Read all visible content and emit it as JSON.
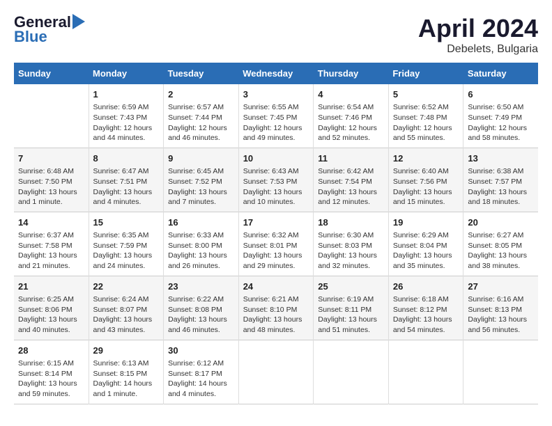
{
  "header": {
    "logo_line1": "General",
    "logo_line2": "Blue",
    "title": "April 2024",
    "subtitle": "Debelets, Bulgaria"
  },
  "days_of_week": [
    "Sunday",
    "Monday",
    "Tuesday",
    "Wednesday",
    "Thursday",
    "Friday",
    "Saturday"
  ],
  "weeks": [
    [
      {
        "day": "",
        "content": ""
      },
      {
        "day": "1",
        "content": "Sunrise: 6:59 AM\nSunset: 7:43 PM\nDaylight: 12 hours\nand 44 minutes."
      },
      {
        "day": "2",
        "content": "Sunrise: 6:57 AM\nSunset: 7:44 PM\nDaylight: 12 hours\nand 46 minutes."
      },
      {
        "day": "3",
        "content": "Sunrise: 6:55 AM\nSunset: 7:45 PM\nDaylight: 12 hours\nand 49 minutes."
      },
      {
        "day": "4",
        "content": "Sunrise: 6:54 AM\nSunset: 7:46 PM\nDaylight: 12 hours\nand 52 minutes."
      },
      {
        "day": "5",
        "content": "Sunrise: 6:52 AM\nSunset: 7:48 PM\nDaylight: 12 hours\nand 55 minutes."
      },
      {
        "day": "6",
        "content": "Sunrise: 6:50 AM\nSunset: 7:49 PM\nDaylight: 12 hours\nand 58 minutes."
      }
    ],
    [
      {
        "day": "7",
        "content": "Sunrise: 6:48 AM\nSunset: 7:50 PM\nDaylight: 13 hours\nand 1 minute."
      },
      {
        "day": "8",
        "content": "Sunrise: 6:47 AM\nSunset: 7:51 PM\nDaylight: 13 hours\nand 4 minutes."
      },
      {
        "day": "9",
        "content": "Sunrise: 6:45 AM\nSunset: 7:52 PM\nDaylight: 13 hours\nand 7 minutes."
      },
      {
        "day": "10",
        "content": "Sunrise: 6:43 AM\nSunset: 7:53 PM\nDaylight: 13 hours\nand 10 minutes."
      },
      {
        "day": "11",
        "content": "Sunrise: 6:42 AM\nSunset: 7:54 PM\nDaylight: 13 hours\nand 12 minutes."
      },
      {
        "day": "12",
        "content": "Sunrise: 6:40 AM\nSunset: 7:56 PM\nDaylight: 13 hours\nand 15 minutes."
      },
      {
        "day": "13",
        "content": "Sunrise: 6:38 AM\nSunset: 7:57 PM\nDaylight: 13 hours\nand 18 minutes."
      }
    ],
    [
      {
        "day": "14",
        "content": "Sunrise: 6:37 AM\nSunset: 7:58 PM\nDaylight: 13 hours\nand 21 minutes."
      },
      {
        "day": "15",
        "content": "Sunrise: 6:35 AM\nSunset: 7:59 PM\nDaylight: 13 hours\nand 24 minutes."
      },
      {
        "day": "16",
        "content": "Sunrise: 6:33 AM\nSunset: 8:00 PM\nDaylight: 13 hours\nand 26 minutes."
      },
      {
        "day": "17",
        "content": "Sunrise: 6:32 AM\nSunset: 8:01 PM\nDaylight: 13 hours\nand 29 minutes."
      },
      {
        "day": "18",
        "content": "Sunrise: 6:30 AM\nSunset: 8:03 PM\nDaylight: 13 hours\nand 32 minutes."
      },
      {
        "day": "19",
        "content": "Sunrise: 6:29 AM\nSunset: 8:04 PM\nDaylight: 13 hours\nand 35 minutes."
      },
      {
        "day": "20",
        "content": "Sunrise: 6:27 AM\nSunset: 8:05 PM\nDaylight: 13 hours\nand 38 minutes."
      }
    ],
    [
      {
        "day": "21",
        "content": "Sunrise: 6:25 AM\nSunset: 8:06 PM\nDaylight: 13 hours\nand 40 minutes."
      },
      {
        "day": "22",
        "content": "Sunrise: 6:24 AM\nSunset: 8:07 PM\nDaylight: 13 hours\nand 43 minutes."
      },
      {
        "day": "23",
        "content": "Sunrise: 6:22 AM\nSunset: 8:08 PM\nDaylight: 13 hours\nand 46 minutes."
      },
      {
        "day": "24",
        "content": "Sunrise: 6:21 AM\nSunset: 8:10 PM\nDaylight: 13 hours\nand 48 minutes."
      },
      {
        "day": "25",
        "content": "Sunrise: 6:19 AM\nSunset: 8:11 PM\nDaylight: 13 hours\nand 51 minutes."
      },
      {
        "day": "26",
        "content": "Sunrise: 6:18 AM\nSunset: 8:12 PM\nDaylight: 13 hours\nand 54 minutes."
      },
      {
        "day": "27",
        "content": "Sunrise: 6:16 AM\nSunset: 8:13 PM\nDaylight: 13 hours\nand 56 minutes."
      }
    ],
    [
      {
        "day": "28",
        "content": "Sunrise: 6:15 AM\nSunset: 8:14 PM\nDaylight: 13 hours\nand 59 minutes."
      },
      {
        "day": "29",
        "content": "Sunrise: 6:13 AM\nSunset: 8:15 PM\nDaylight: 14 hours\nand 1 minute."
      },
      {
        "day": "30",
        "content": "Sunrise: 6:12 AM\nSunset: 8:17 PM\nDaylight: 14 hours\nand 4 minutes."
      },
      {
        "day": "",
        "content": ""
      },
      {
        "day": "",
        "content": ""
      },
      {
        "day": "",
        "content": ""
      },
      {
        "day": "",
        "content": ""
      }
    ]
  ]
}
